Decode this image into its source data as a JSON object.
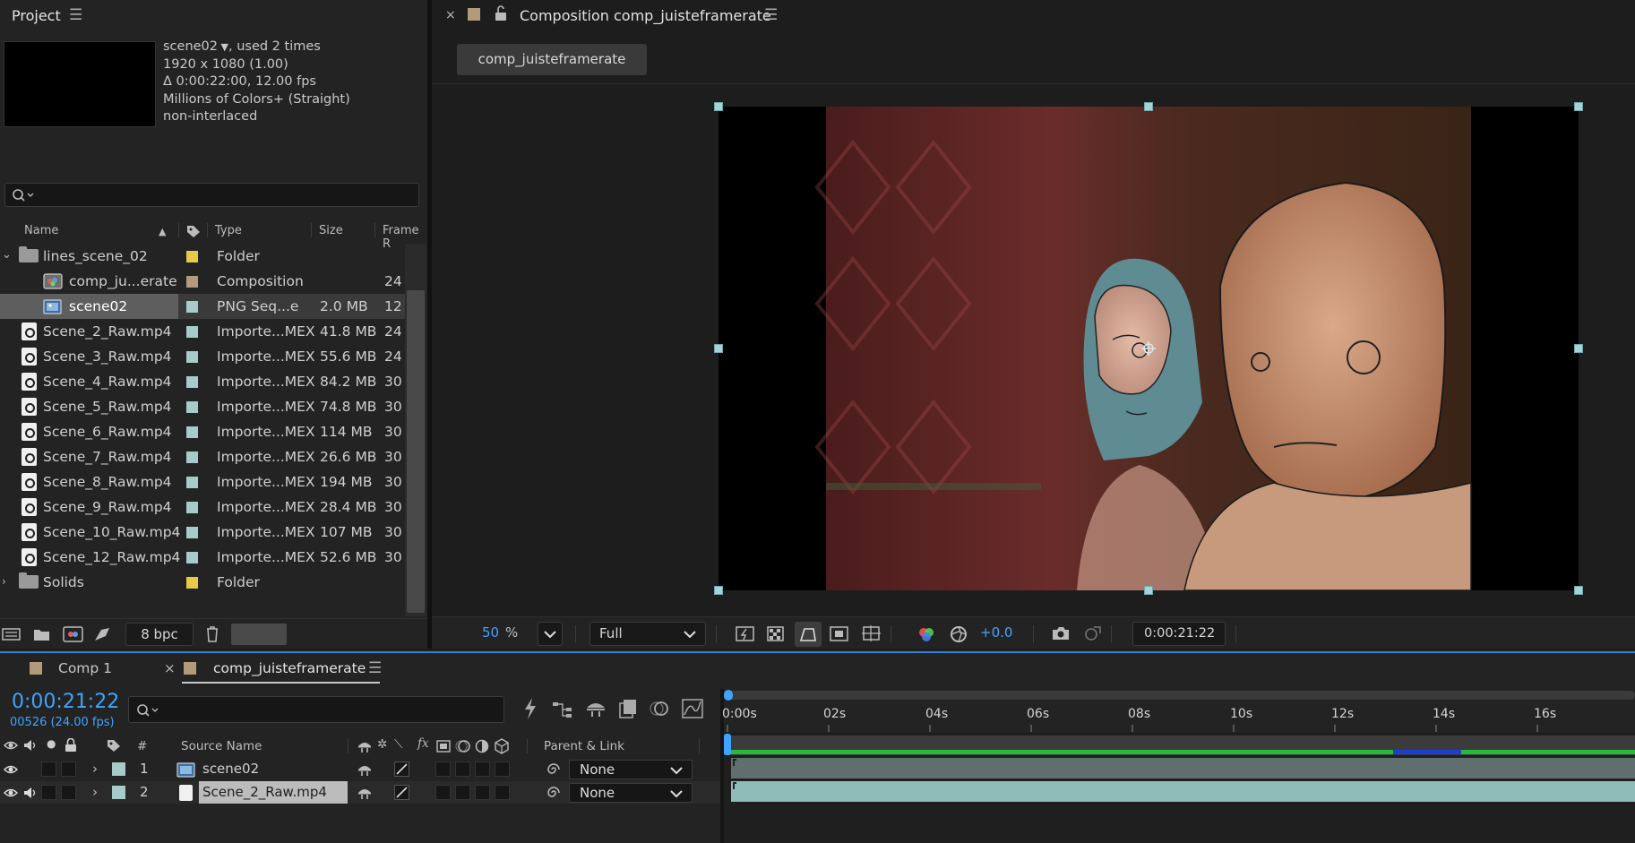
{
  "project": {
    "title": "Project",
    "info": {
      "name": "scene02",
      "used": ", used 2 times",
      "resolution": "1920 x 1080 (1.00)",
      "duration": "Δ 0:00:22:00, 12.00 fps",
      "colors": "Millions of Colors+ (Straight)",
      "field": "non-interlaced"
    },
    "search_placeholder": "",
    "columns": {
      "name": "Name",
      "type": "Type",
      "size": "Size",
      "frame_rate": "Frame R"
    },
    "items": [
      {
        "name": "lines_scene_02",
        "type": "Folder",
        "size": "",
        "fps": "",
        "color": "#e8c94a",
        "kind": "folder",
        "expanded": true
      },
      {
        "name": "comp_ju...erate",
        "type": "Composition",
        "size": "",
        "fps": "24",
        "color": "#b39a7a",
        "kind": "comp"
      },
      {
        "name": "scene02",
        "type": "PNG Seq...e",
        "size": "2.0 MB",
        "fps": "12",
        "color": "#a6cbc9",
        "kind": "seq",
        "selected": true
      },
      {
        "name": "Scene_2_Raw.mp4",
        "type": "Importe...MEX",
        "size": "41.8 MB",
        "fps": "24",
        "color": "#a6cbc9",
        "kind": "movie"
      },
      {
        "name": "Scene_3_Raw.mp4",
        "type": "Importe...MEX",
        "size": "55.6 MB",
        "fps": "24",
        "color": "#a6cbc9",
        "kind": "movie"
      },
      {
        "name": "Scene_4_Raw.mp4",
        "type": "Importe...MEX",
        "size": "84.2 MB",
        "fps": "30",
        "color": "#a6cbc9",
        "kind": "movie"
      },
      {
        "name": "Scene_5_Raw.mp4",
        "type": "Importe...MEX",
        "size": "74.8 MB",
        "fps": "30",
        "color": "#a6cbc9",
        "kind": "movie"
      },
      {
        "name": "Scene_6_Raw.mp4",
        "type": "Importe...MEX",
        "size": "114 MB",
        "fps": "30",
        "color": "#a6cbc9",
        "kind": "movie"
      },
      {
        "name": "Scene_7_Raw.mp4",
        "type": "Importe...MEX",
        "size": "26.6 MB",
        "fps": "30",
        "color": "#a6cbc9",
        "kind": "movie"
      },
      {
        "name": "Scene_8_Raw.mp4",
        "type": "Importe...MEX",
        "size": "194 MB",
        "fps": "30",
        "color": "#a6cbc9",
        "kind": "movie"
      },
      {
        "name": "Scene_9_Raw.mp4",
        "type": "Importe...MEX",
        "size": "28.4 MB",
        "fps": "30",
        "color": "#a6cbc9",
        "kind": "movie"
      },
      {
        "name": "Scene_10_Raw.mp4",
        "type": "Importe...MEX",
        "size": "107 MB",
        "fps": "30",
        "color": "#a6cbc9",
        "kind": "movie"
      },
      {
        "name": "Scene_12_Raw.mp4",
        "type": "Importe...MEX",
        "size": "52.6 MB",
        "fps": "30",
        "color": "#a6cbc9",
        "kind": "movie"
      },
      {
        "name": "Solids",
        "type": "Folder",
        "size": "",
        "fps": "",
        "color": "#e8c94a",
        "kind": "folder",
        "expanded": false
      }
    ],
    "footer": {
      "bpc": "8 bpc"
    }
  },
  "composition": {
    "tab_title": "Composition comp_juisteframerate",
    "flowchart_tab": "comp_juisteframerate",
    "footer": {
      "zoom": "50",
      "zoom_unit": "%",
      "resolution": "Full",
      "exposure": "+0.0",
      "timecode": "0:00:21:22"
    }
  },
  "timeline": {
    "tabs": [
      {
        "label": "Comp 1",
        "color": "#b39a7a",
        "active": false
      },
      {
        "label": "comp_juisteframerate",
        "color": "#b39a7a",
        "active": true
      }
    ],
    "current_time": "0:00:21:22",
    "frame_info": "00526 (24.00 fps)",
    "search_placeholder": "",
    "columns": {
      "number": "#",
      "source_name": "Source Name",
      "fx": "fx",
      "parent": "Parent & Link"
    },
    "layers": [
      {
        "number": "1",
        "name": "scene02",
        "parent": "None",
        "color": "#a6cbc9",
        "selected": false
      },
      {
        "number": "2",
        "name": "Scene_2_Raw.mp4",
        "parent": "None",
        "color": "#a6cbc9",
        "selected": true
      }
    ],
    "ruler_ticks": [
      "0:00s",
      "02s",
      "04s",
      "06s",
      "08s",
      "10s",
      "12s",
      "14s",
      "16s"
    ]
  },
  "colors": {
    "accent_blue": "#3fa4ff",
    "handle": "#a9d2d6",
    "work_area_green": "#27b93a",
    "work_area_blue": "#1a3fd1",
    "layer_bar": "#8fbcb8"
  }
}
